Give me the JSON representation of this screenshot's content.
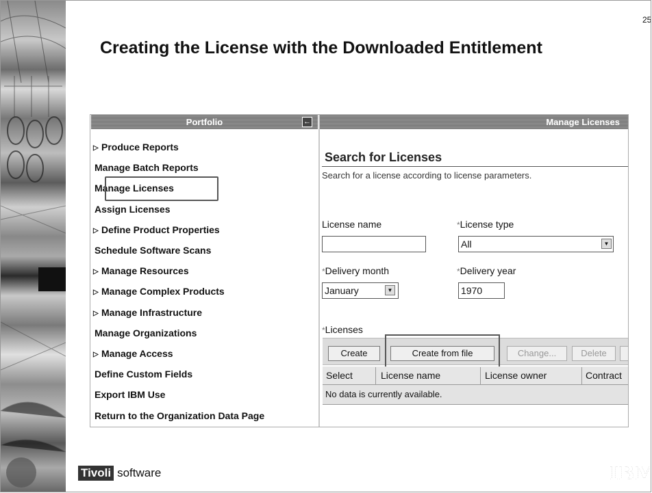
{
  "page": {
    "number": "25",
    "title": "Creating the License with the Downloaded Entitlement"
  },
  "portfolio": {
    "header": "Portfolio",
    "collapse_icon": "←",
    "items": [
      {
        "label": "Produce Reports",
        "expandable": true
      },
      {
        "label": "Manage Batch Reports",
        "expandable": false
      },
      {
        "label": "Manage Licenses",
        "expandable": false
      },
      {
        "label": "Assign Licenses",
        "expandable": false
      },
      {
        "label": "Define Product Properties",
        "expandable": true
      },
      {
        "label": "Schedule Software Scans",
        "expandable": false
      },
      {
        "label": "Manage Resources",
        "expandable": true
      },
      {
        "label": "Manage Complex Products",
        "expandable": true
      },
      {
        "label": "Manage Infrastructure",
        "expandable": true
      },
      {
        "label": "Manage Organizations",
        "expandable": false
      },
      {
        "label": "Manage Access",
        "expandable": true
      },
      {
        "label": "Define Custom Fields",
        "expandable": false
      },
      {
        "label": "Export IBM Use",
        "expandable": false
      },
      {
        "label": "Return to the Organization Data Page",
        "expandable": false
      }
    ]
  },
  "main": {
    "header": "Manage Licenses",
    "search_title": "Search for Licenses",
    "search_desc": "Search for a license according to license parameters.",
    "fields": {
      "license_name_label": "License name",
      "license_name_value": "",
      "license_type_label": "License type",
      "license_type_value": "All",
      "delivery_month_label": "Delivery month",
      "delivery_month_value": "January",
      "delivery_year_label": "Delivery year",
      "delivery_year_value": "1970",
      "required_marker": "*"
    },
    "licenses_label": "Licenses",
    "toolbar": {
      "create": "Create",
      "create_from_file": "Create from file",
      "change": "Change...",
      "delete": "Delete"
    },
    "table": {
      "columns": [
        "Select",
        "License name",
        "License owner",
        "Contract"
      ],
      "empty_message": "No data is currently available."
    }
  },
  "footer": {
    "tivoli": "Tivoli",
    "software": "software",
    "ibm": "IBM"
  }
}
